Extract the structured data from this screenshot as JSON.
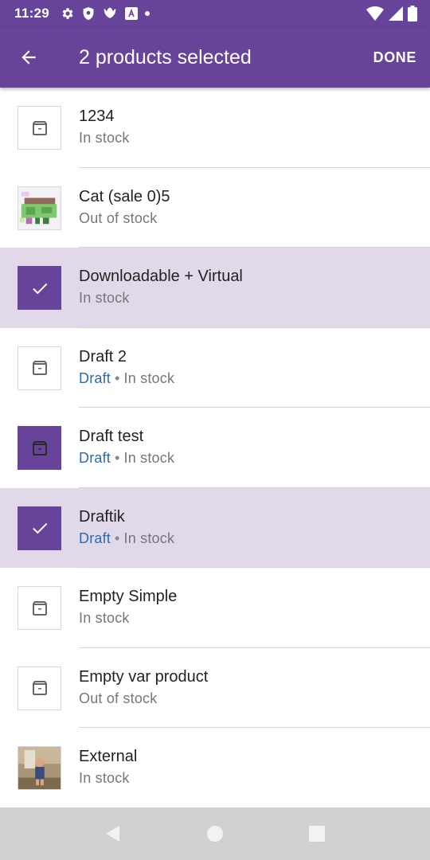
{
  "status_bar": {
    "time": "11:29"
  },
  "header": {
    "title": "2 products selected",
    "done_label": "DONE"
  },
  "products": [
    {
      "name": "1234",
      "stock": "In stock",
      "draft": "",
      "thumb": "placeholder",
      "selected": false
    },
    {
      "name": "Cat (sale 0)5",
      "stock": "Out of stock",
      "draft": "",
      "thumb": "cat-image",
      "selected": false
    },
    {
      "name": "Downloadable + Virtual",
      "stock": "In stock",
      "draft": "",
      "thumb": "check",
      "selected": true
    },
    {
      "name": "Draft 2",
      "stock": "In stock",
      "draft": "Draft",
      "thumb": "placeholder",
      "selected": false
    },
    {
      "name": "Draft test",
      "stock": "In stock",
      "draft": "Draft",
      "thumb": "placeholder-filled",
      "selected": false
    },
    {
      "name": "Draftik",
      "stock": "In stock",
      "draft": "Draft",
      "thumb": "check",
      "selected": true
    },
    {
      "name": "Empty Simple",
      "stock": "In stock",
      "draft": "",
      "thumb": "placeholder",
      "selected": false
    },
    {
      "name": "Empty var product",
      "stock": "Out of stock",
      "draft": "",
      "thumb": "placeholder",
      "selected": false
    },
    {
      "name": "External",
      "stock": "In stock",
      "draft": "",
      "thumb": "photo",
      "selected": false
    }
  ],
  "colors": {
    "primary": "#674399",
    "selected_row": "#e1d8ea",
    "draft_link": "#2b6cb4",
    "nav_bar": "#d1d1d1"
  }
}
